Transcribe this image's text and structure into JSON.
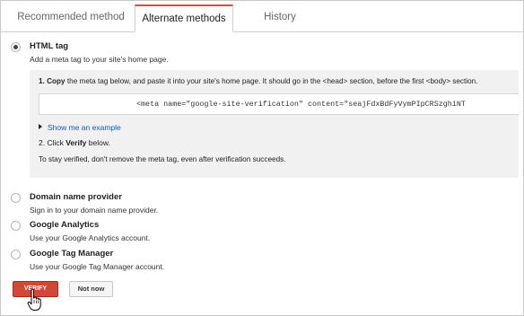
{
  "tabs": [
    {
      "label": "Recommended method"
    },
    {
      "label": "Alternate methods"
    },
    {
      "label": "History"
    }
  ],
  "options": [
    {
      "title": "HTML tag",
      "description": "Add a meta tag to your site's home page.",
      "selected": true
    },
    {
      "title": "Domain name provider",
      "description": "Sign in to your domain name provider.",
      "selected": false
    },
    {
      "title": "Google Analytics",
      "description": "Use your Google Analytics account.",
      "selected": false
    },
    {
      "title": "Google Tag Manager",
      "description": "Use your Google Tag Manager account.",
      "selected": false
    }
  ],
  "html_tag_panel": {
    "step1_number": "1.",
    "step1_bold": "Copy",
    "step1_rest": " the meta tag below, and paste it into your site's home page. It should go in the <head> section, before the first <body> section.",
    "meta_tag": "<meta name=\"google-site-verification\" content=\"seajFdxBdFyVymPIpCRSzghiNT",
    "show_example": "Show me an example",
    "step2_prefix": "2. Click ",
    "step2_bold": "Verify",
    "step2_suffix": " below.",
    "stay_verified": "To stay verified, don't remove the meta tag, even after verification succeeds."
  },
  "buttons": {
    "verify": "VERIFY",
    "not_now": "Not now"
  },
  "colors": {
    "accent_red": "#d14836",
    "link_blue": "#1155cc",
    "panel_bg": "#f1f1f1"
  }
}
